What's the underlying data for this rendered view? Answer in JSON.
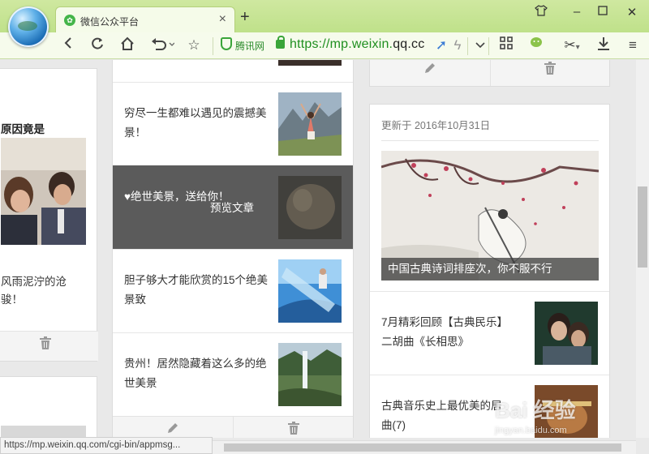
{
  "browser": {
    "tab_title": "微信公众平台",
    "tab_close": "×",
    "new_tab": "+",
    "security_label": "腾讯网",
    "url_prefix": "https://mp.weixin.",
    "url_domain": "qq.cc",
    "status_url": "https://mp.weixin.qq.com/cgi-bin/appmsg..."
  },
  "left_column": {
    "headline": "原因竟是",
    "caption_line1": "风雨泥泞的沧",
    "caption_line2": "骏！"
  },
  "middle_column": {
    "items": [
      {
        "title": "穷尽一生都难以遇见的震撼美景！"
      },
      {
        "title": "♥绝世美景，送给你！",
        "overlay": "预览文章"
      },
      {
        "title": "胆子够大才能欣赏的15个绝美景致"
      },
      {
        "title": "贵州！居然隐藏着这么多的绝世美景"
      }
    ]
  },
  "right_column": {
    "updated": "更新于 2016年10月31日",
    "cover_title": "中国古典诗词排座次，你不服不行",
    "items": [
      {
        "title": "7月精彩回顾【古典民乐】二胡曲《长相思》"
      },
      {
        "title": "古典音乐史上最优美的居曲(7)"
      }
    ]
  },
  "watermark": {
    "brand": "Bai 经验",
    "site": "jingyan.baidu.com"
  },
  "colors": {
    "chrome": "#bfe18a",
    "url_green": "#1f8f1f",
    "overlay": "#5b5b5b"
  }
}
